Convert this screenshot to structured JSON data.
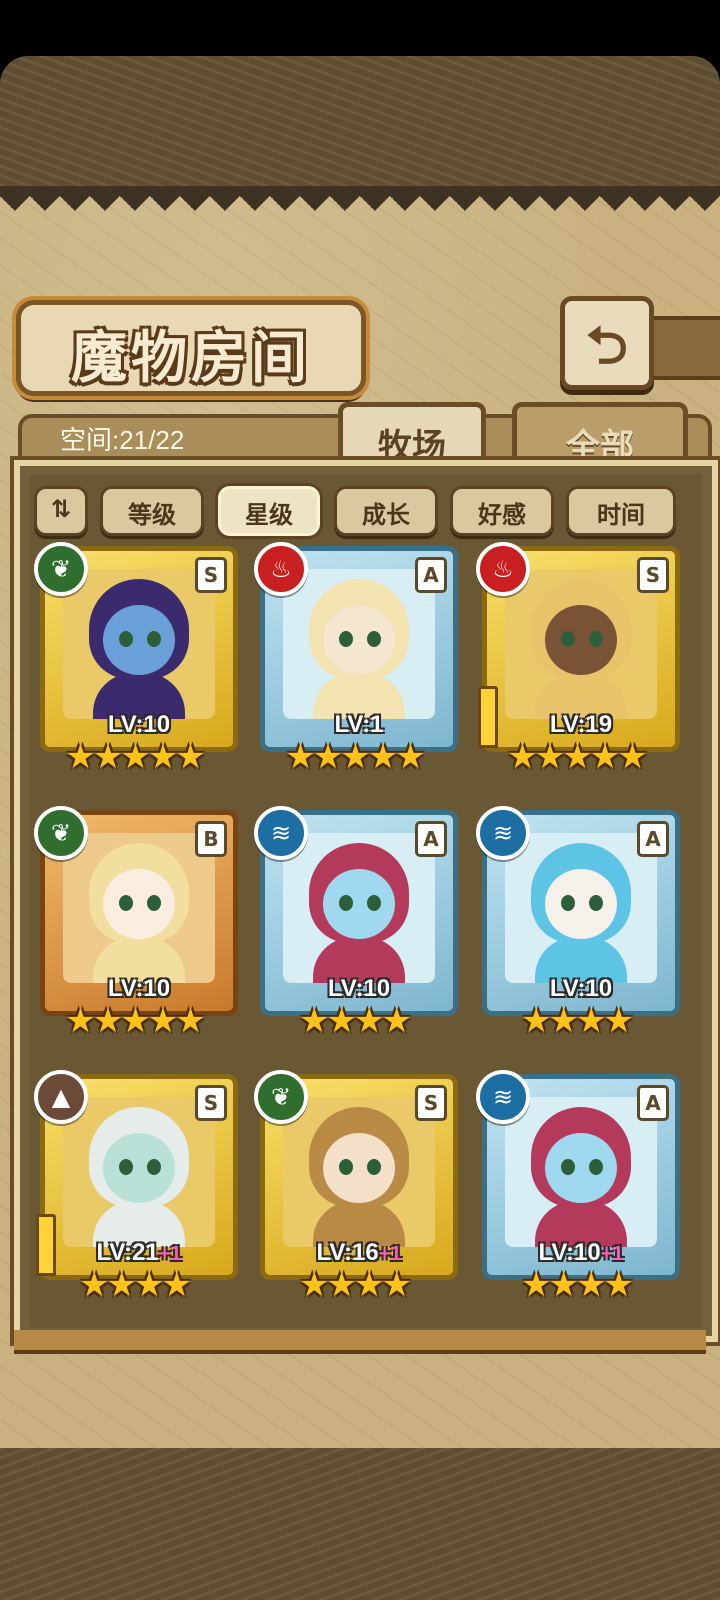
{
  "header": {
    "title": "魔物房间",
    "back_icon": "back-arrow-icon"
  },
  "tabs": {
    "space_label": "空间:21/22",
    "items": [
      {
        "label": "牧场",
        "active": true
      },
      {
        "label": "全部",
        "active": false
      }
    ]
  },
  "sort": {
    "toggle_icon": "sort-order-icon",
    "options": [
      {
        "label": "等级",
        "selected": false
      },
      {
        "label": "星级",
        "selected": true
      },
      {
        "label": "成长",
        "selected": false
      },
      {
        "label": "好感",
        "selected": false
      },
      {
        "label": "时间",
        "selected": false
      }
    ]
  },
  "monsters": [
    {
      "level": "LV:10",
      "plus": "",
      "rank": "S",
      "element": "grass",
      "frame": "gold",
      "stars": 5,
      "weapon": false
    },
    {
      "level": "LV:1",
      "plus": "",
      "rank": "A",
      "element": "fire",
      "frame": "blue",
      "stars": 5,
      "weapon": false
    },
    {
      "level": "LV:19",
      "plus": "",
      "rank": "S",
      "element": "fire",
      "frame": "gold",
      "stars": 5,
      "weapon": true
    },
    {
      "level": "LV:10",
      "plus": "",
      "rank": "B",
      "element": "grass",
      "frame": "orange",
      "stars": 5,
      "weapon": false
    },
    {
      "level": "LV:10",
      "plus": "",
      "rank": "A",
      "element": "water",
      "frame": "blue",
      "stars": 4,
      "weapon": false
    },
    {
      "level": "LV:10",
      "plus": "",
      "rank": "A",
      "element": "water",
      "frame": "blue",
      "stars": 4,
      "weapon": false
    },
    {
      "level": "LV:21",
      "plus": "+1",
      "rank": "S",
      "element": "earth",
      "frame": "gold",
      "stars": 4,
      "weapon": true
    },
    {
      "level": "LV:16",
      "plus": "+1",
      "rank": "S",
      "element": "grass",
      "frame": "gold",
      "stars": 4,
      "weapon": false
    },
    {
      "level": "LV:10",
      "plus": "+1",
      "rank": "A",
      "element": "water",
      "frame": "blue",
      "stars": 4,
      "weapon": false
    }
  ],
  "colors": {
    "parchment": "#c9b27f",
    "gold_frame": "#d8a81c",
    "blue_frame": "#7eb6cf",
    "orange_frame": "#c87a2c",
    "star": "#ffc21a"
  }
}
